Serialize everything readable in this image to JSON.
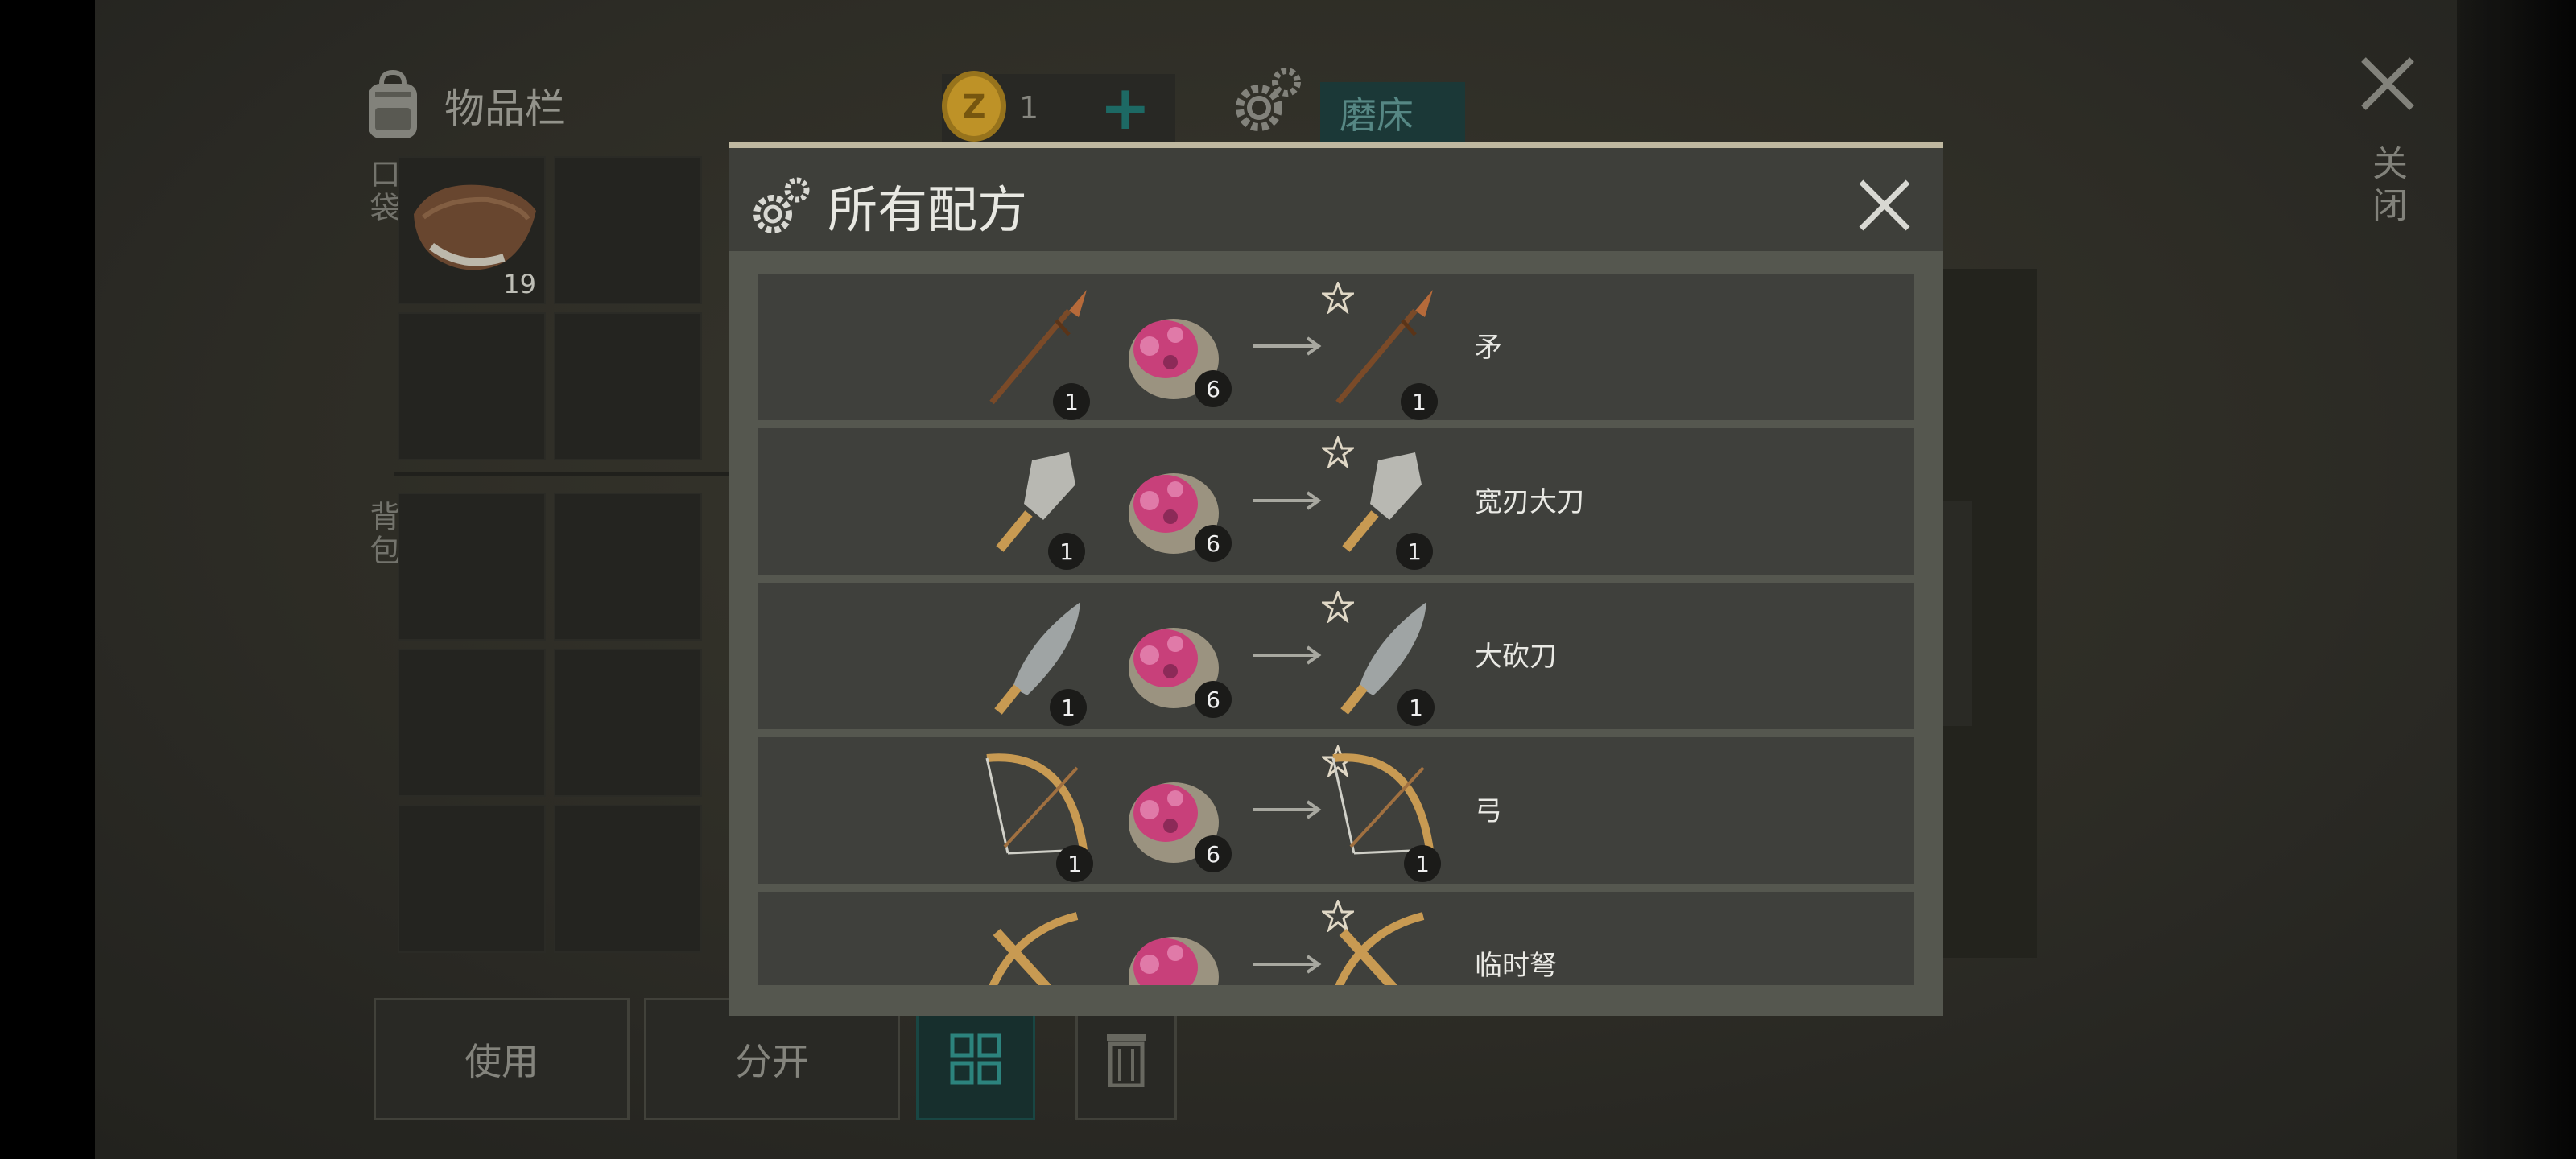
{
  "inventory": {
    "title": "物品栏",
    "pocket_label": "口袋",
    "backpack_label": "背包",
    "slot_item_qty": "19"
  },
  "topbar": {
    "coin_count": "1",
    "workstation_tab": "磨床",
    "close_label": "关闭"
  },
  "actions": {
    "use": "使用",
    "split": "分开"
  },
  "modal": {
    "title": "所有配方",
    "recipes": [
      {
        "name": "矛",
        "input_qty": "1",
        "material_qty": "6",
        "output_qty": "1",
        "tool": "spear-icon"
      },
      {
        "name": "宽刃大刀",
        "input_qty": "1",
        "material_qty": "6",
        "output_qty": "1",
        "tool": "cleaver-icon"
      },
      {
        "name": "大砍刀",
        "input_qty": "1",
        "material_qty": "6",
        "output_qty": "1",
        "tool": "machete-icon"
      },
      {
        "name": "弓",
        "input_qty": "1",
        "material_qty": "6",
        "output_qty": "1",
        "tool": "bow-icon"
      },
      {
        "name": "临时弩",
        "input_qty": "",
        "material_qty": "",
        "output_qty": "",
        "tool": "crossbow-icon"
      }
    ]
  },
  "colors": {
    "accent_teal": "#1d3c3a",
    "modal_bg": "#55574f",
    "row_bg": "#3f403c",
    "ore_pink": "#c8407a"
  }
}
